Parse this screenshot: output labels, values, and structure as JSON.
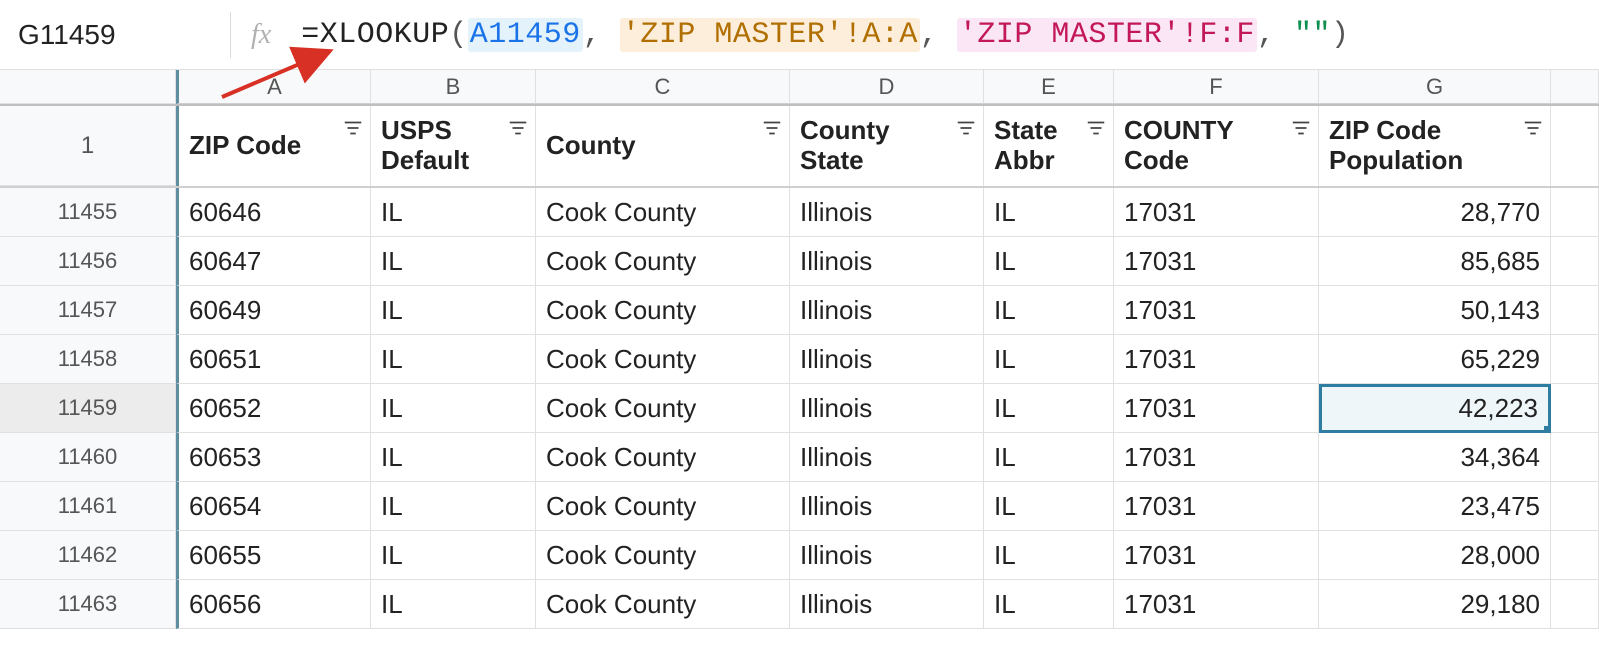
{
  "name_box": "G11459",
  "fx_label": "fx",
  "formula": {
    "eq": "=",
    "fn": "XLOOKUP",
    "open": "(",
    "arg1": "A11459",
    "c1": ", ",
    "arg2": "'ZIP MASTER'!A:A",
    "c2": ", ",
    "arg3": "'ZIP MASTER'!F:F",
    "c3": ", ",
    "arg4": "\"\"",
    "close": ")"
  },
  "column_letters": [
    "A",
    "B",
    "C",
    "D",
    "E",
    "F",
    "G"
  ],
  "header_row_num": "1",
  "headers": {
    "A": "ZIP Code",
    "B": "USPS Default",
    "C": "County",
    "D": "County State",
    "E": "State Abbr",
    "F": "COUNTY Code",
    "G": "ZIP Code Population"
  },
  "rows": [
    {
      "num": "11455",
      "A": "60646",
      "B": "IL",
      "C": "Cook County",
      "D": "Illinois",
      "E": "IL",
      "F": "17031",
      "G": "28,770"
    },
    {
      "num": "11456",
      "A": "60647",
      "B": "IL",
      "C": "Cook County",
      "D": "Illinois",
      "E": "IL",
      "F": "17031",
      "G": "85,685"
    },
    {
      "num": "11457",
      "A": "60649",
      "B": "IL",
      "C": "Cook County",
      "D": "Illinois",
      "E": "IL",
      "F": "17031",
      "G": "50,143"
    },
    {
      "num": "11458",
      "A": "60651",
      "B": "IL",
      "C": "Cook County",
      "D": "Illinois",
      "E": "IL",
      "F": "17031",
      "G": "65,229"
    },
    {
      "num": "11459",
      "A": "60652",
      "B": "IL",
      "C": "Cook County",
      "D": "Illinois",
      "E": "IL",
      "F": "17031",
      "G": "42,223"
    },
    {
      "num": "11460",
      "A": "60653",
      "B": "IL",
      "C": "Cook County",
      "D": "Illinois",
      "E": "IL",
      "F": "17031",
      "G": "34,364"
    },
    {
      "num": "11461",
      "A": "60654",
      "B": "IL",
      "C": "Cook County",
      "D": "Illinois",
      "E": "IL",
      "F": "17031",
      "G": "23,475"
    },
    {
      "num": "11462",
      "A": "60655",
      "B": "IL",
      "C": "Cook County",
      "D": "Illinois",
      "E": "IL",
      "F": "17031",
      "G": "28,000"
    },
    {
      "num": "11463",
      "A": "60656",
      "B": "IL",
      "C": "Cook County",
      "D": "Illinois",
      "E": "IL",
      "F": "17031",
      "G": "29,180"
    }
  ],
  "selected_row_index": 4,
  "colors": {
    "ref1_bg": "#e3f2fb",
    "ref1_fg": "#1a73e8",
    "ref2_bg": "#fdeedb",
    "ref2_fg": "#b06f00",
    "ref3_bg": "#fae6f4",
    "ref3_fg": "#c2185b",
    "selection": "#2f7da0",
    "arrow": "#d93025"
  }
}
